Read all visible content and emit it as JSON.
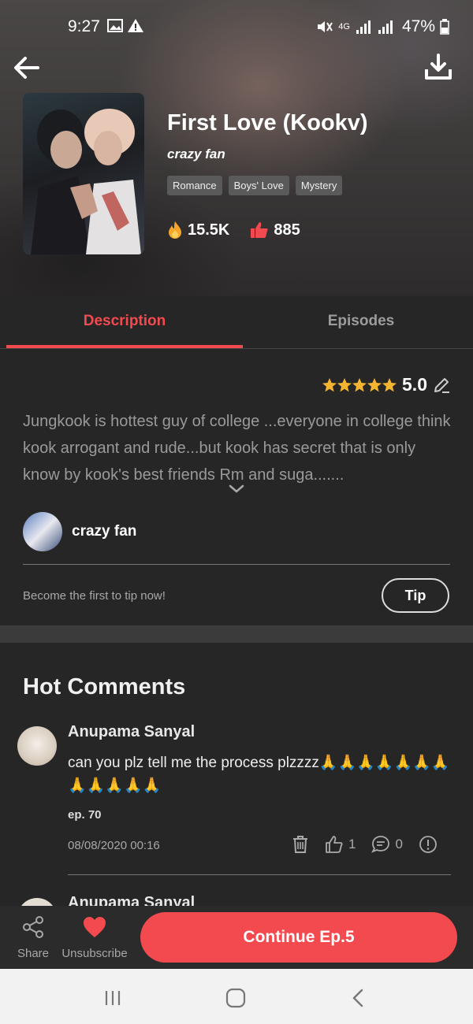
{
  "status": {
    "time": "9:27",
    "network": "4G",
    "battery": "47%"
  },
  "book": {
    "title": "First Love (Kookv)",
    "author": "crazy fan",
    "tags": [
      "Romance",
      "Boys' Love",
      "Mystery"
    ],
    "views": "15.5K",
    "likes": "885"
  },
  "tabs": {
    "description": "Description",
    "episodes": "Episodes"
  },
  "description": {
    "rating": "5.0",
    "text": "Jungkook is hottest guy of college ...everyone in college think kook arrogant and rude...but kook has secret that is only know by kook's best friends Rm and suga.......",
    "author_name": "crazy fan",
    "tip_prompt": "Become the first to tip now!",
    "tip_button": "Tip"
  },
  "comments": {
    "section_title": "Hot Comments",
    "items": [
      {
        "name": "Anupama Sanyal",
        "text": "can you plz tell me the process plzzzz🙏🙏🙏🙏🙏🙏🙏🙏🙏🙏🙏🙏",
        "episode": "ep. 70",
        "date": "08/08/2020 00:16",
        "likes": "1",
        "replies": "0"
      },
      {
        "name": "Anupama Sanyal"
      }
    ]
  },
  "bottom_bar": {
    "share_label": "Share",
    "unsubscribe_label": "Unsubscribe",
    "continue_label": "Continue Ep.5"
  },
  "colors": {
    "accent": "#f24a4f",
    "background": "#262626",
    "star": "#f5b531"
  }
}
